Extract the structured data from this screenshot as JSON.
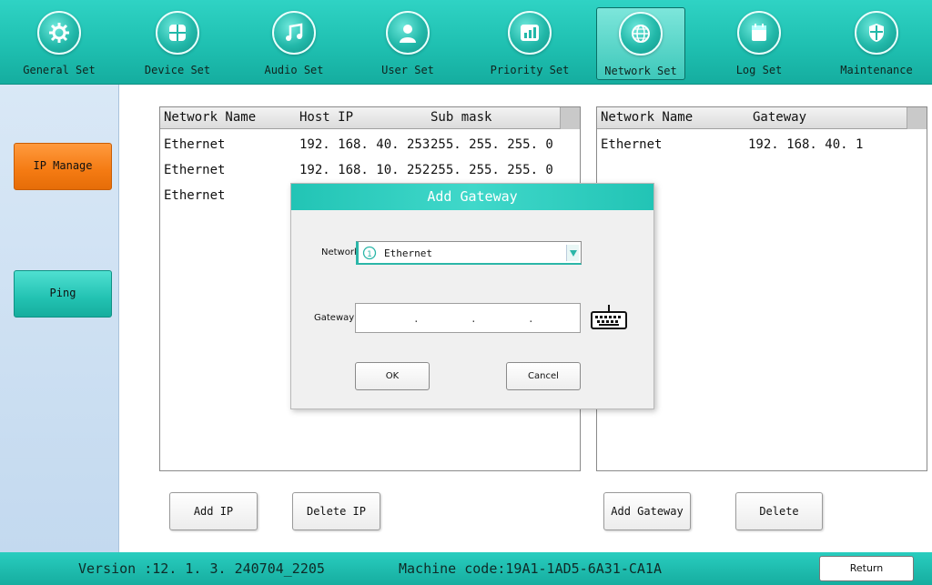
{
  "nav": [
    {
      "label": "General Set",
      "icon": "gear-icon"
    },
    {
      "label": "Device Set",
      "icon": "grid-icon"
    },
    {
      "label": "Audio Set",
      "icon": "music-note-icon"
    },
    {
      "label": "User Set",
      "icon": "user-icon"
    },
    {
      "label": "Priority Set",
      "icon": "bar-chart-icon"
    },
    {
      "label": "Network Set",
      "icon": "globe-icon",
      "active": true
    },
    {
      "label": "Log Set",
      "icon": "calendar-icon"
    },
    {
      "label": "Maintenance",
      "icon": "shield-icon"
    }
  ],
  "sidebar": {
    "items": [
      {
        "label": "IP Manage",
        "color": "#f47a12"
      },
      {
        "label": "Ping",
        "color": "#22c2b2"
      }
    ]
  },
  "ip_table": {
    "headers": [
      "Network Name",
      "Host IP",
      "Sub mask"
    ],
    "rows": [
      [
        "Ethernet",
        "192. 168. 40. 253",
        "255. 255. 255. 0"
      ],
      [
        "Ethernet",
        "192. 168. 10. 252",
        "255. 255. 255. 0"
      ],
      [
        "Ethernet",
        "",
        ""
      ]
    ]
  },
  "gateway_table": {
    "headers": [
      "Network Name",
      "Gateway"
    ],
    "rows": [
      [
        "Ethernet",
        "192. 168. 40. 1"
      ]
    ]
  },
  "buttons": {
    "add_ip": "Add IP",
    "delete_ip": "Delete IP",
    "add_gateway": "Add Gateway",
    "delete": "Delete"
  },
  "dialog": {
    "title": "Add Gateway",
    "network_label": "Network",
    "network_value": "Ethernet",
    "gateway_label": "Gateway",
    "ok": "OK",
    "cancel": "Cancel"
  },
  "footer": {
    "version": "Version :12. 1. 3. 240704_2205",
    "machine_code": "Machine code:19A1-1AD5-6A31-CA1A",
    "return_label": "Return"
  },
  "colors": {
    "accent": "#1fc0b1",
    "active_sidebar": "#f47a12"
  }
}
